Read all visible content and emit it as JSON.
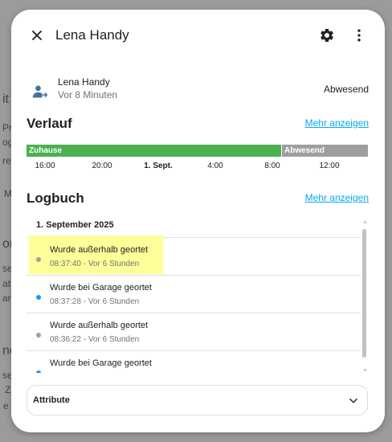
{
  "background": {
    "fragments": [
      "it",
      "Pr",
      "og",
      "re",
      "M",
      "or",
      "se",
      "ati",
      "anc",
      "ne",
      "se",
      "Z",
      "e"
    ]
  },
  "dialog": {
    "title": "Lena Handy",
    "close_icon": "close-icon",
    "settings_icon": "gear-icon",
    "menu_icon": "more-vertical-icon"
  },
  "entity": {
    "icon": "account-arrow-icon",
    "name": "Lena Handy",
    "last_changed": "Vor 8 Minuten",
    "state": "Abwesend"
  },
  "history": {
    "title": "Verlauf",
    "more_link": "Mehr anzeigen",
    "segments": [
      {
        "label": "Zuhause",
        "color": "#4caf50"
      },
      {
        "label": "Abwesend",
        "color": "#9e9e9e"
      }
    ],
    "ticks": [
      "16:00",
      "20:00",
      "1. Sept.",
      "4:00",
      "8:00",
      "12:00"
    ]
  },
  "logbook": {
    "title": "Logbuch",
    "more_link": "Mehr anzeigen",
    "date": "1. September 2025",
    "entries": [
      {
        "message": "Wurde außerhalb geortet",
        "meta": "08:37:40 - Vor 6 Stunden",
        "dot_color": "#9e9e9e"
      },
      {
        "message": "Wurde bei Garage geortet",
        "meta": "08:37:28 - Vor 6 Stunden",
        "dot_color": "#2196f3"
      },
      {
        "message": "Wurde außerhalb geortet",
        "meta": "08:36:22 - Vor 6 Stunden",
        "dot_color": "#9e9e9e"
      },
      {
        "message": "Wurde bei Garage geortet",
        "meta": "",
        "dot_color": "#2196f3"
      }
    ]
  },
  "attributes": {
    "label": "Attribute",
    "chevron_icon": "chevron-down-icon"
  }
}
